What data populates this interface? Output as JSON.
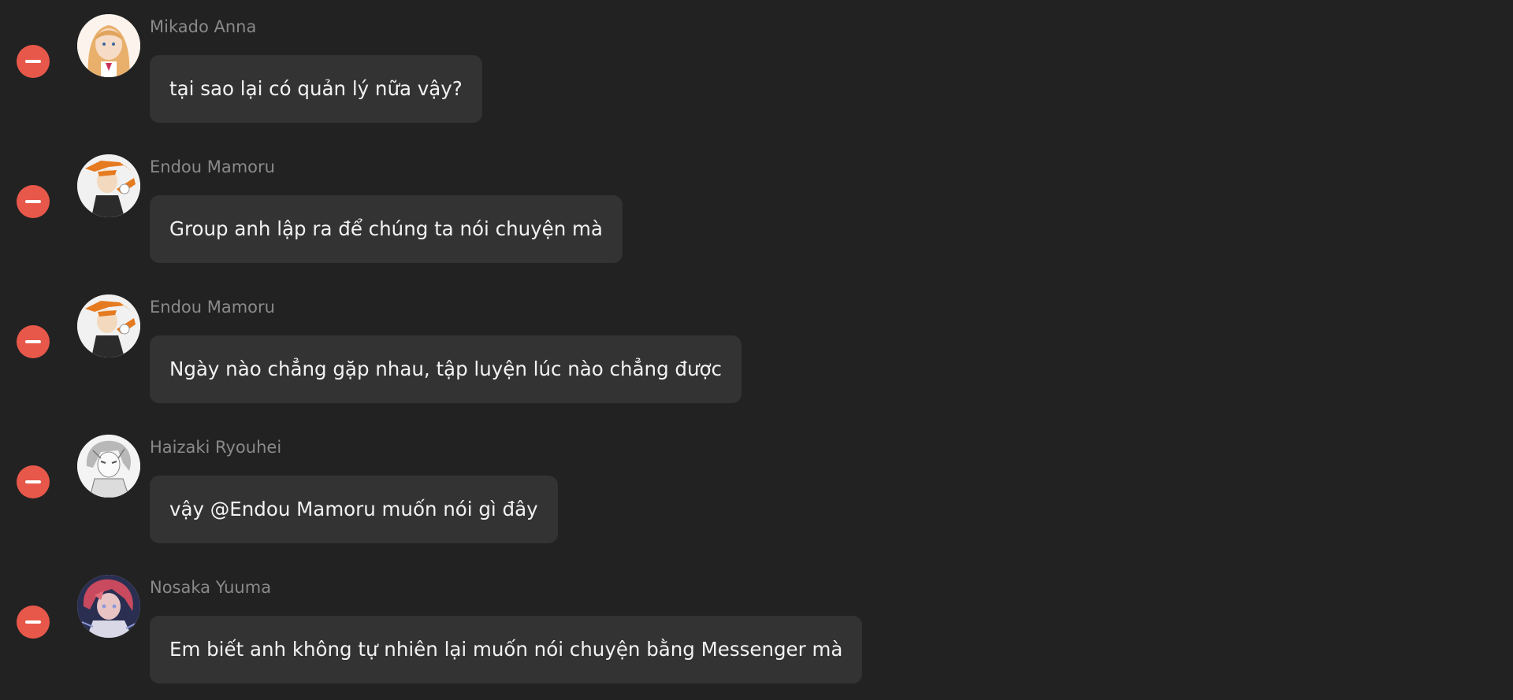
{
  "messages": [
    {
      "sender": "Mikado Anna",
      "text": "tại sao lại có quản lý nữa vậy?",
      "avatar_icon": "avatar-mikado-anna",
      "avatar_colors": [
        "#f6dcc6",
        "#e9b06b",
        "#c8325a"
      ]
    },
    {
      "sender": "Endou Mamoru",
      "text": "Group anh lập ra để chúng ta nói chuyện mà",
      "avatar_icon": "avatar-endou-mamoru",
      "avatar_colors": [
        "#f1f1f1",
        "#e57a1f",
        "#2b2b2b"
      ]
    },
    {
      "sender": "Endou Mamoru",
      "text": "Ngày nào chẳng gặp nhau, tập luyện lúc nào chẳng được",
      "avatar_icon": "avatar-endou-mamoru",
      "avatar_colors": [
        "#f1f1f1",
        "#e57a1f",
        "#2b2b2b"
      ]
    },
    {
      "sender": "Haizaki Ryouhei",
      "text": "vậy @Endou Mamoru muốn nói gì đây",
      "avatar_icon": "avatar-haizaki-ryouhei",
      "avatar_colors": [
        "#f4f4f4",
        "#b8b8b8",
        "#555555"
      ]
    },
    {
      "sender": "Nosaka Yuuma",
      "text": "Em biết anh không tự nhiên lại muốn nói chuyện bằng Messenger mà",
      "avatar_icon": "avatar-nosaka-yuuma",
      "avatar_colors": [
        "#2a2f52",
        "#c94a5e",
        "#8f9ad8"
      ]
    }
  ],
  "remove_icon": "minus-circle-icon",
  "colors": {
    "background": "#222222",
    "bubble": "#333333",
    "remove": "#e8584a",
    "sender": "#8a8a8a",
    "text": "#f2f2f2"
  }
}
